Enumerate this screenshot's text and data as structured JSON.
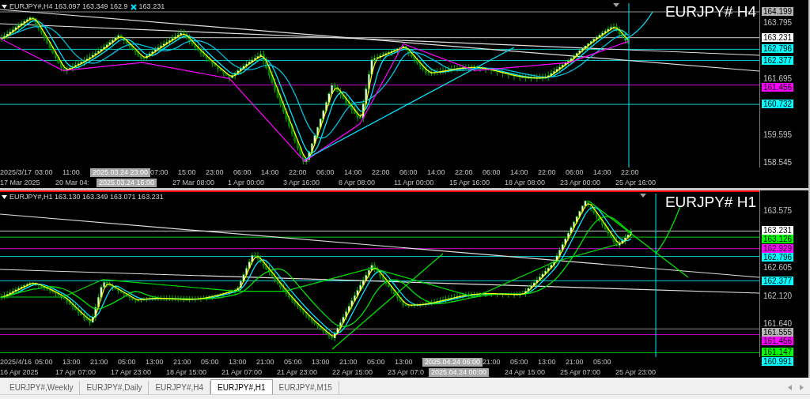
{
  "panels": [
    {
      "header": "EURJPY#,H4 163.097 163.349 162.9",
      "header_close": "163.231",
      "symbol_label": "EURJPY# H4",
      "active": false,
      "price_axis": [
        {
          "text": "164.199",
          "kind": "tag",
          "color": "#b4b4b4"
        },
        {
          "text": "163.795",
          "kind": "tick"
        },
        {
          "text": "163.231",
          "kind": "tag",
          "color": "#ffffff"
        },
        {
          "text": "162.796",
          "kind": "tag",
          "color": "#00ffff"
        },
        {
          "text": "162.377",
          "kind": "tag",
          "color": "#00ffff"
        },
        {
          "text": "161.695",
          "kind": "tick"
        },
        {
          "text": "161.456",
          "kind": "tag",
          "color": "#ff00ff"
        },
        {
          "text": "160.732",
          "kind": "tag",
          "color": "#00ffff"
        },
        {
          "text": "159.595",
          "kind": "tick"
        },
        {
          "text": "158.545",
          "kind": "tick"
        }
      ],
      "time_axis_top": [
        {
          "text": "2025/3/17",
          "kind": "first"
        },
        {
          "text": "03:00",
          "kind": "label"
        },
        {
          "text": "11:00",
          "kind": "label"
        },
        {
          "text": "2025.03.24 23:00",
          "kind": "cursor"
        },
        {
          "text": "07:00",
          "kind": "label"
        },
        {
          "text": "15:00",
          "kind": "label"
        },
        {
          "text": "23:00",
          "kind": "label"
        },
        {
          "text": "06:00",
          "kind": "label"
        },
        {
          "text": "14:00",
          "kind": "label"
        },
        {
          "text": "22:00",
          "kind": "label"
        },
        {
          "text": "06:00",
          "kind": "label"
        },
        {
          "text": "14:00",
          "kind": "label"
        },
        {
          "text": "22:00",
          "kind": "label"
        },
        {
          "text": "06:00",
          "kind": "label"
        },
        {
          "text": "14:00",
          "kind": "label"
        },
        {
          "text": "22:00",
          "kind": "label"
        },
        {
          "text": "06:00",
          "kind": "label"
        },
        {
          "text": "14:00",
          "kind": "label"
        },
        {
          "text": "22:00",
          "kind": "label"
        },
        {
          "text": "06:00",
          "kind": "label"
        },
        {
          "text": "14:00",
          "kind": "label"
        },
        {
          "text": "22:00",
          "kind": "label"
        }
      ],
      "time_axis_bottom": [
        {
          "text": "17 Mar 2025",
          "kind": "label"
        },
        {
          "text": "20 Mar 04:",
          "kind": "part"
        },
        {
          "text": "2025.03.24 16:00",
          "kind": "cursor"
        },
        {
          "text": "27 Mar 08:00",
          "kind": "label"
        },
        {
          "text": "1 Apr 00:00",
          "kind": "label"
        },
        {
          "text": "3 Apr 16:00",
          "kind": "label"
        },
        {
          "text": "8 Apr 08:00",
          "kind": "label"
        },
        {
          "text": "11 Apr 00:00",
          "kind": "label"
        },
        {
          "text": "15 Apr 16:00",
          "kind": "label"
        },
        {
          "text": "18 Apr 08:00",
          "kind": "label"
        },
        {
          "text": "23 Apr 00:00",
          "kind": "label"
        },
        {
          "text": "25 Apr 16:00",
          "kind": "label"
        }
      ]
    },
    {
      "header": "EURJPY#,H1 163.130 163.349 163.071 163.231",
      "symbol_label": "EURJPY# H1",
      "active": true,
      "price_axis": [
        {
          "text": "163.575",
          "kind": "tick"
        },
        {
          "text": "163.231",
          "kind": "tag",
          "color": "#ffffff"
        },
        {
          "text": "163.126",
          "kind": "tag",
          "color": "#00ff00"
        },
        {
          "text": "162.929",
          "kind": "tag",
          "color": "#ff00ff"
        },
        {
          "text": "162.796",
          "kind": "tag",
          "color": "#00ffff"
        },
        {
          "text": "162.605",
          "kind": "tick"
        },
        {
          "text": "162.377",
          "kind": "tag",
          "color": "#00ffff"
        },
        {
          "text": "162.120",
          "kind": "tick"
        },
        {
          "text": "161.640",
          "kind": "tick"
        },
        {
          "text": "161.555",
          "kind": "tag",
          "color": "#b4b4b4"
        },
        {
          "text": "161.456",
          "kind": "tag",
          "color": "#ff00ff"
        },
        {
          "text": "161.147",
          "kind": "tag",
          "color": "#00ff00"
        },
        {
          "text": "160.991",
          "kind": "tag",
          "color": "#00ffff"
        }
      ],
      "time_axis_top": [
        {
          "text": "2025/4/16",
          "kind": "first"
        },
        {
          "text": "05:00",
          "kind": "label"
        },
        {
          "text": "13:00",
          "kind": "label"
        },
        {
          "text": "21:00",
          "kind": "label"
        },
        {
          "text": "05:00",
          "kind": "label"
        },
        {
          "text": "13:00",
          "kind": "label"
        },
        {
          "text": "21:00",
          "kind": "label"
        },
        {
          "text": "05:00",
          "kind": "label"
        },
        {
          "text": "13:00",
          "kind": "label"
        },
        {
          "text": "21:00",
          "kind": "label"
        },
        {
          "text": "05:00",
          "kind": "label"
        },
        {
          "text": "13:00",
          "kind": "label"
        },
        {
          "text": "21:00",
          "kind": "label"
        },
        {
          "text": "05:00",
          "kind": "label"
        },
        {
          "text": "13:00",
          "kind": "label"
        },
        {
          "text": "2025.04.24 06:00",
          "kind": "cursor"
        },
        {
          "text": "21:00",
          "kind": "label"
        },
        {
          "text": "05:00",
          "kind": "label"
        },
        {
          "text": "13:00",
          "kind": "label"
        },
        {
          "text": "21:00",
          "kind": "label"
        },
        {
          "text": "05:00",
          "kind": "label"
        }
      ],
      "time_axis_bottom": [
        {
          "text": "16 Apr 2025",
          "kind": "label"
        },
        {
          "text": "17 Apr 07:00",
          "kind": "label"
        },
        {
          "text": "17 Apr 23:00",
          "kind": "label"
        },
        {
          "text": "18 Apr 15:00",
          "kind": "label"
        },
        {
          "text": "21 Apr 07:00",
          "kind": "label"
        },
        {
          "text": "21 Apr 23:00",
          "kind": "label"
        },
        {
          "text": "22 Apr 15:00",
          "kind": "label"
        },
        {
          "text": "23 Apr 07:0",
          "kind": "part"
        },
        {
          "text": "2025.04.24 00:00",
          "kind": "cursor"
        },
        {
          "text": "24 Apr 15:00",
          "kind": "label"
        },
        {
          "text": "25 Apr 07:00",
          "kind": "label"
        },
        {
          "text": "25 Apr 23:00",
          "kind": "label"
        }
      ]
    }
  ],
  "tabs": [
    {
      "label": "EURJPY#,Weekly",
      "selected": false
    },
    {
      "label": "EURJPY#,Daily",
      "selected": false
    },
    {
      "label": "EURJPY#,H4",
      "selected": false
    },
    {
      "label": "EURJPY#,H1",
      "selected": true
    },
    {
      "label": "EURJPY#,M15",
      "selected": false
    }
  ]
}
